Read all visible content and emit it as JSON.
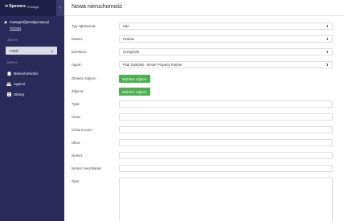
{
  "app": {
    "brand": "Spewers",
    "brand_sub": "Prestige"
  },
  "sidebar": {
    "collapse_icon": "chevron-left-icon",
    "user_email": "manager@prestigecasa.pl",
    "logout_label": "Wyloguj",
    "language_section": "JĘZYK",
    "language_value": "Polski",
    "menu_section": "MENU",
    "items": [
      {
        "label": "Nieruchomości",
        "icon": "building-icon"
      },
      {
        "label": "Agenci",
        "icon": "users-icon"
      },
      {
        "label": "Strony",
        "icon": "pages-icon"
      }
    ]
  },
  "main": {
    "title": "Nowa nieruchomość",
    "fields": {
      "type": {
        "label": "Typ ogłoszenia:",
        "value": "sale"
      },
      "city": {
        "label": "Miasto:",
        "value": "Kraków"
      },
      "district": {
        "label": "Dzielnica:",
        "value": "Grzegórzki"
      },
      "agent": {
        "label": "Agent:",
        "value": "Piotr Zarębski - Senior Property Partner"
      },
      "main_image": {
        "label": "Główne zdjęcie:",
        "button": "Wybierz zdjęcie"
      },
      "images": {
        "label": "Zdjęcia:",
        "button": "Wybierz zdjęcie"
      },
      "title": {
        "label": "Tytuł:",
        "value": ""
      },
      "price": {
        "label": "Cena:",
        "value": ""
      },
      "price_eur": {
        "label": "Cena w euro:",
        "value": ""
      },
      "street": {
        "label": "Ulica:",
        "value": ""
      },
      "number": {
        "label": "Numer:",
        "value": ""
      },
      "apartment": {
        "label": "Numer mieszkania:",
        "value": ""
      },
      "description": {
        "label": "Opis:",
        "value": ""
      }
    }
  },
  "colors": {
    "sidebar_bg": "#2a2a5a",
    "sidebar_header_bg": "#1e1e46",
    "button_green": "#4caf50"
  }
}
